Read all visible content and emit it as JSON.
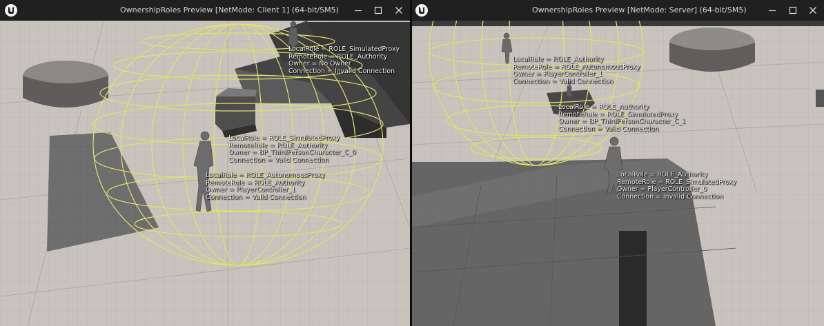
{
  "colors": {
    "titlebar": "#202020",
    "title_text": "#d8d8d8",
    "floor": "#c7c2bc",
    "grid": "#b2ada7",
    "sphere_wire": "#e0e36a",
    "debug_text": "#f2f2f2"
  },
  "client_window": {
    "title": "OwnershipRoles Preview [NetMode: Client 1]  (64-bit/SM5)",
    "icons": [
      "unreal-logo-icon",
      "minimize-icon",
      "maximize-icon",
      "close-icon"
    ],
    "labels": [
      {
        "local": "LocalRole = ROLE_SimulatedProxy",
        "remote": "RemoteRole = ROLE_Authority",
        "owner": "Owner = No Owner",
        "connection": "Connection = Invalid Connection"
      },
      {
        "local": "LocalRole = ROLE_SimulatedProxy",
        "remote": "RemoteRole = ROLE_Authority",
        "owner": "Owner = BP_ThirdPersonCharacter_C_0",
        "connection": "Connection = Valid Connection"
      },
      {
        "local": "LocalRole = ROLE_AutonomousProxy",
        "remote": "RemoteRole = ROLE_Authority",
        "owner": "Owner = PlayerController_1",
        "connection": "Connection = Valid Connection"
      }
    ]
  },
  "server_window": {
    "title": "OwnershipRoles Preview [NetMode: Server]  (64-bit/SM5)",
    "icons": [
      "unreal-logo-icon",
      "minimize-icon",
      "maximize-icon",
      "close-icon"
    ],
    "labels": [
      {
        "local": "LocalRole = ROLE_Authority",
        "remote": "RemoteRole = ROLE_AutonomousProxy",
        "owner": "Owner = PlayerController_1",
        "connection": "Connection = Valid Connection"
      },
      {
        "local": "LocalRole = ROLE_Authority",
        "remote": "RemoteRole = ROLE_SimulatedProxy",
        "owner": "Owner = BP_ThirdPersonCharacter_C_1",
        "connection": "Connection = Valid Connection"
      },
      {
        "local": "LocalRole = ROLE_Authority",
        "remote": "RemoteRole = ROLE_SimulatedProxy",
        "owner": "Owner = PlayerController_0",
        "connection": "Connection = Invalid Connection"
      }
    ]
  }
}
